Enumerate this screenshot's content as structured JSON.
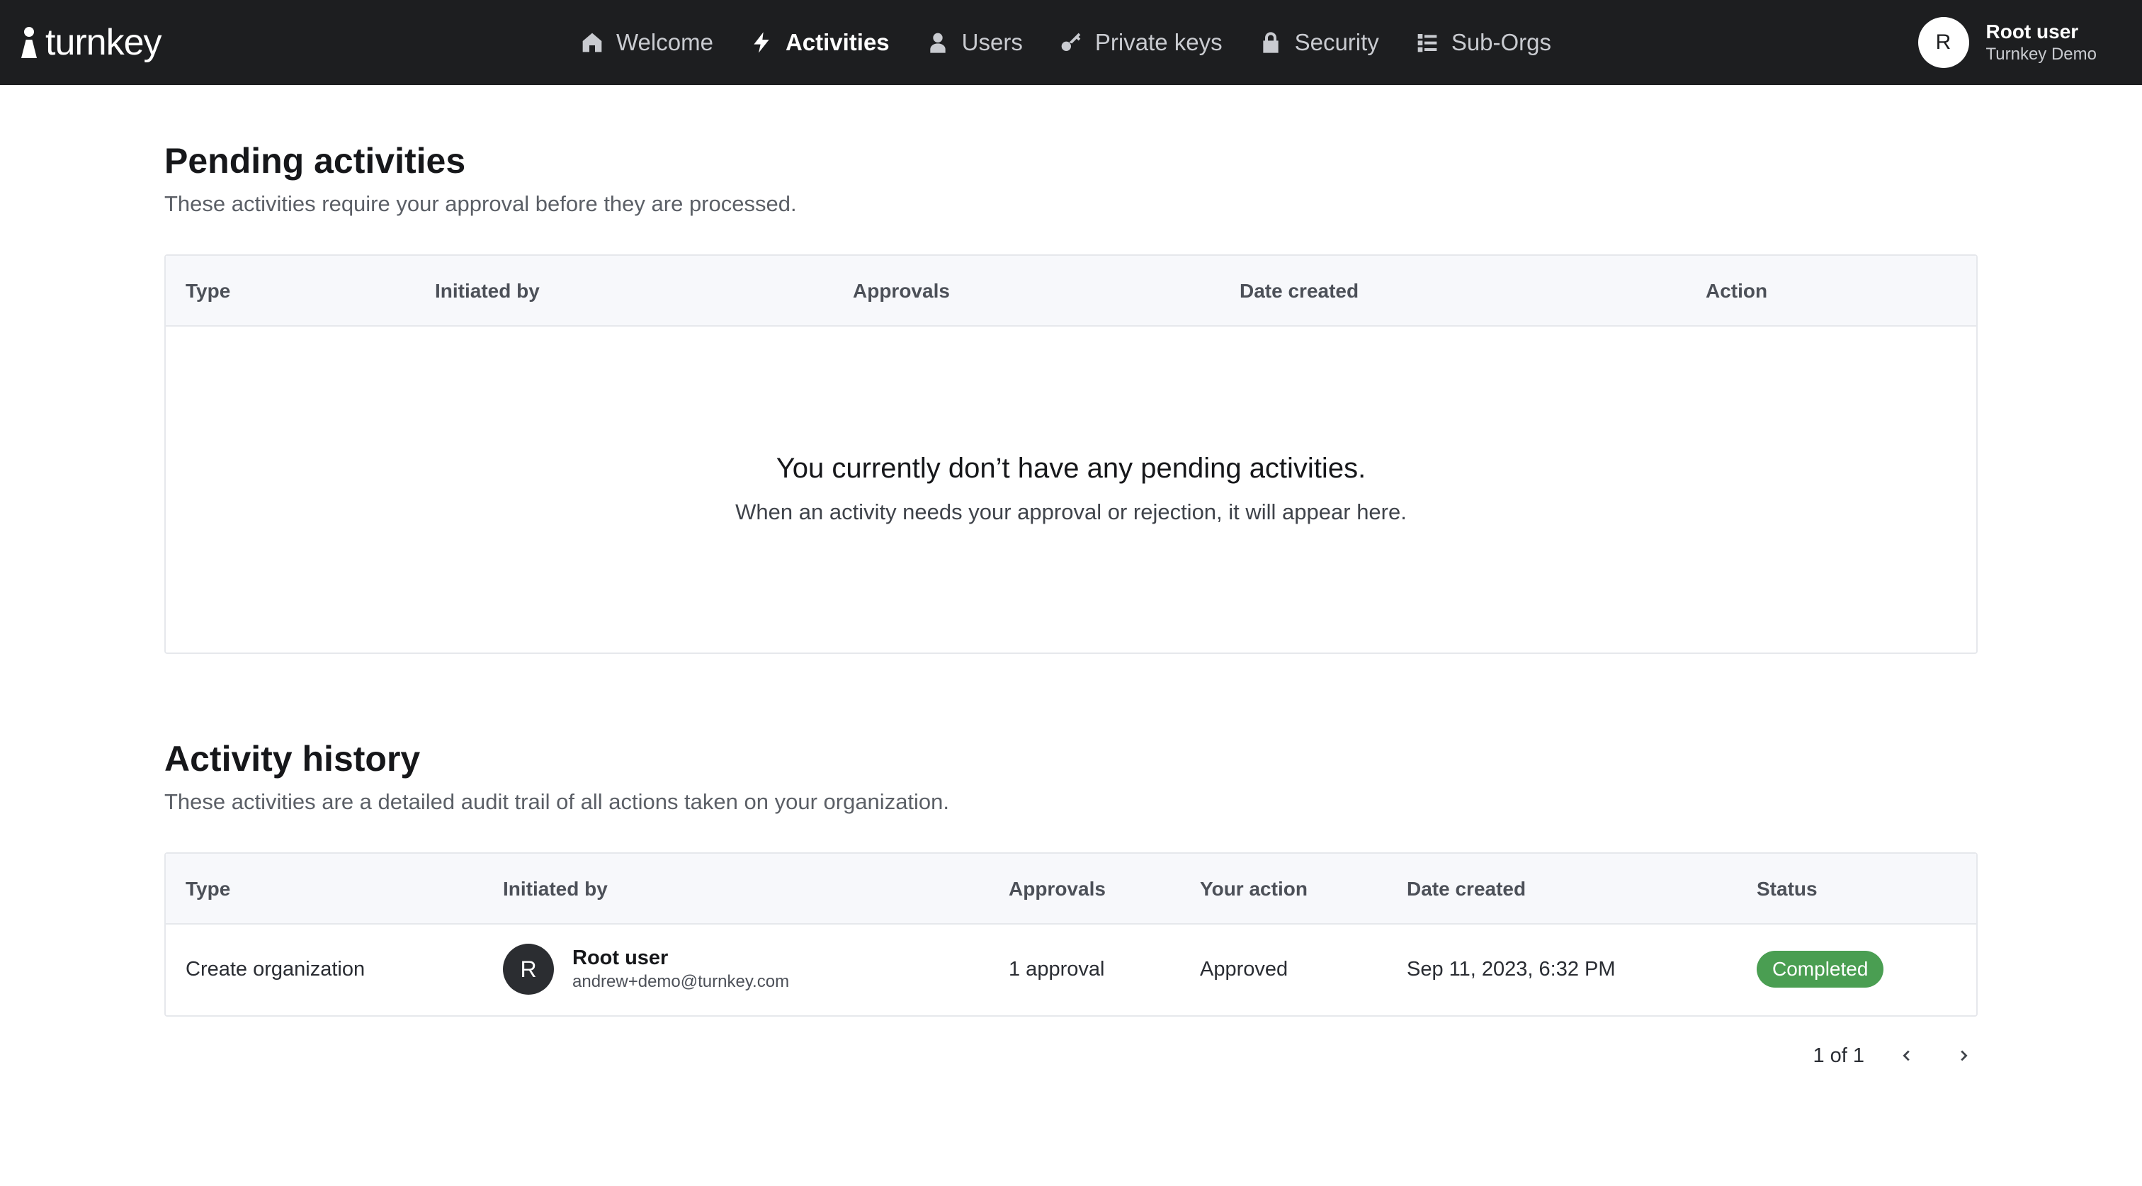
{
  "app": {
    "logo_text": "turnkey"
  },
  "nav": {
    "items": [
      {
        "label": "Welcome",
        "icon": "home-icon"
      },
      {
        "label": "Activities",
        "icon": "bolt-icon",
        "active": true
      },
      {
        "label": "Users",
        "icon": "user-icon"
      },
      {
        "label": "Private keys",
        "icon": "key-icon"
      },
      {
        "label": "Security",
        "icon": "lock-icon"
      },
      {
        "label": "Sub-Orgs",
        "icon": "list-icon"
      }
    ]
  },
  "account": {
    "initial": "R",
    "name": "Root user",
    "org": "Turnkey Demo"
  },
  "pending": {
    "title": "Pending activities",
    "subtitle": "These activities require your approval before they are processed.",
    "columns": [
      "Type",
      "Initiated by",
      "Approvals",
      "Date created",
      "Action"
    ],
    "empty_title": "You currently don’t have any pending activities.",
    "empty_subtitle": "When an activity needs your approval or rejection, it will appear here."
  },
  "history": {
    "title": "Activity history",
    "subtitle": "These activities are a detailed audit trail of all actions taken on your organization.",
    "columns": [
      "Type",
      "Initiated by",
      "Approvals",
      "Your action",
      "Date created",
      "Status"
    ],
    "rows": [
      {
        "type": "Create organization",
        "initiator_initial": "R",
        "initiator_name": "Root user",
        "initiator_email": "andrew+demo@turnkey.com",
        "approvals": "1 approval",
        "your_action": "Approved",
        "date_created": "Sep 11, 2023, 6:32 PM",
        "status": "Completed"
      }
    ]
  },
  "pagination": {
    "label": "1 of 1"
  },
  "colors": {
    "topbar": "#1d1e20",
    "status_completed": "#4a9e52"
  }
}
